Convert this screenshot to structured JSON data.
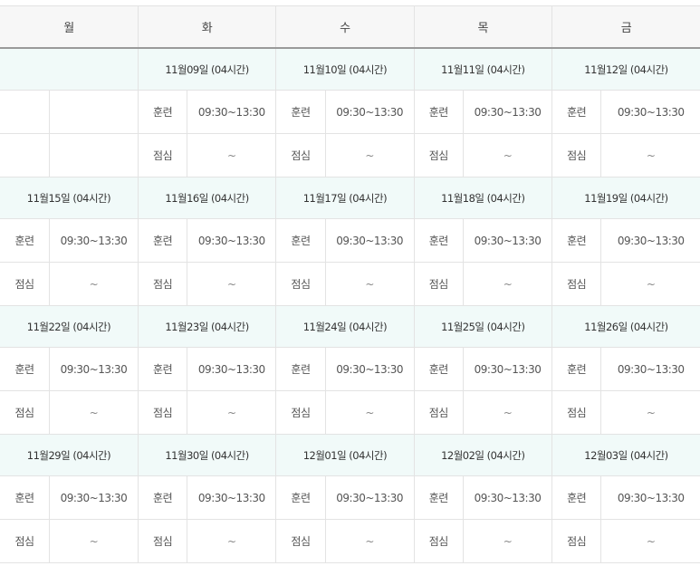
{
  "days": [
    "월",
    "화",
    "수",
    "목",
    "금"
  ],
  "weeks": [
    {
      "dates": [
        "",
        "11월09일 (04시간)",
        "11월10일 (04시간)",
        "11월11일 (04시간)",
        "11월12일 (04시간)"
      ],
      "training": [
        [
          "",
          ""
        ],
        [
          "훈련",
          "09:30~13:30"
        ],
        [
          "훈련",
          "09:30~13:30"
        ],
        [
          "훈련",
          "09:30~13:30"
        ],
        [
          "훈련",
          "09:30~13:30"
        ]
      ],
      "lunch": [
        [
          "",
          ""
        ],
        [
          "점심",
          "~"
        ],
        [
          "점심",
          "~"
        ],
        [
          "점심",
          "~"
        ],
        [
          "점심",
          "~"
        ]
      ]
    },
    {
      "dates": [
        "11월15일 (04시간)",
        "11월16일 (04시간)",
        "11월17일 (04시간)",
        "11월18일 (04시간)",
        "11월19일 (04시간)"
      ],
      "training": [
        [
          "훈련",
          "09:30~13:30"
        ],
        [
          "훈련",
          "09:30~13:30"
        ],
        [
          "훈련",
          "09:30~13:30"
        ],
        [
          "훈련",
          "09:30~13:30"
        ],
        [
          "훈련",
          "09:30~13:30"
        ]
      ],
      "lunch": [
        [
          "점심",
          "~"
        ],
        [
          "점심",
          "~"
        ],
        [
          "점심",
          "~"
        ],
        [
          "점심",
          "~"
        ],
        [
          "점심",
          "~"
        ]
      ]
    },
    {
      "dates": [
        "11월22일 (04시간)",
        "11월23일 (04시간)",
        "11월24일 (04시간)",
        "11월25일 (04시간)",
        "11월26일 (04시간)"
      ],
      "training": [
        [
          "훈련",
          "09:30~13:30"
        ],
        [
          "훈련",
          "09:30~13:30"
        ],
        [
          "훈련",
          "09:30~13:30"
        ],
        [
          "훈련",
          "09:30~13:30"
        ],
        [
          "훈련",
          "09:30~13:30"
        ]
      ],
      "lunch": [
        [
          "점심",
          "~"
        ],
        [
          "점심",
          "~"
        ],
        [
          "점심",
          "~"
        ],
        [
          "점심",
          "~"
        ],
        [
          "점심",
          "~"
        ]
      ]
    },
    {
      "dates": [
        "11월29일 (04시간)",
        "11월30일 (04시간)",
        "12월01일 (04시간)",
        "12월02일 (04시간)",
        "12월03일 (04시간)"
      ],
      "training": [
        [
          "훈련",
          "09:30~13:30"
        ],
        [
          "훈련",
          "09:30~13:30"
        ],
        [
          "훈련",
          "09:30~13:30"
        ],
        [
          "훈련",
          "09:30~13:30"
        ],
        [
          "훈련",
          "09:30~13:30"
        ]
      ],
      "lunch": [
        [
          "점심",
          "~"
        ],
        [
          "점심",
          "~"
        ],
        [
          "점심",
          "~"
        ],
        [
          "점심",
          "~"
        ],
        [
          "점심",
          "~"
        ]
      ]
    }
  ],
  "colors": {
    "header_bg": "#f7f7f7",
    "date_row_bg": "#f1faf9",
    "border": "#e3e3e3",
    "header_underline": "#9a9a9a"
  }
}
